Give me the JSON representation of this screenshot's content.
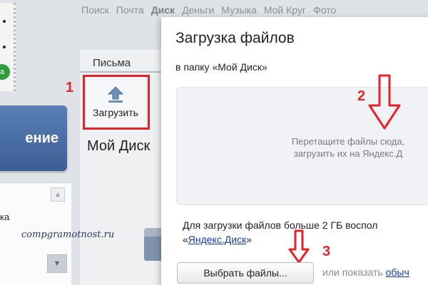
{
  "topnav": {
    "items": [
      "Поиск",
      "Почта",
      "Диск",
      "Деньги",
      "Музыка",
      "Мой Круг",
      "Фото"
    ],
    "active": "Диск"
  },
  "left": {
    "compose_label": "ение",
    "panel_label": "ка",
    "watermark": "compgramotnost.ru"
  },
  "toolbar": {
    "tab_label": "Письма",
    "upload_label": "Загрузить",
    "disk_title": "Мой Диск"
  },
  "dialog": {
    "title": "Загрузка файлов",
    "subtitle": "в папку «Мой Диск»",
    "drop_line1": "Перетащите файлы сюда,",
    "drop_line2": "загрузить их на Яндекс.Д",
    "note_text": "Для загрузки файлов больше 2 ГБ воспол",
    "note_link_prefix": "«",
    "note_link": "Яндекс.Диск",
    "note_link_suffix": "»",
    "choose_button": "Выбрать файлы...",
    "or_show": "или показать ",
    "or_show_link": "обыч"
  },
  "annotations": {
    "mark1": "1",
    "mark2": "2",
    "mark3": "3"
  },
  "colors": {
    "annotation_red": "#e2232a",
    "link_blue": "#0f3fa8",
    "compose_blue": "#3b5f95"
  }
}
